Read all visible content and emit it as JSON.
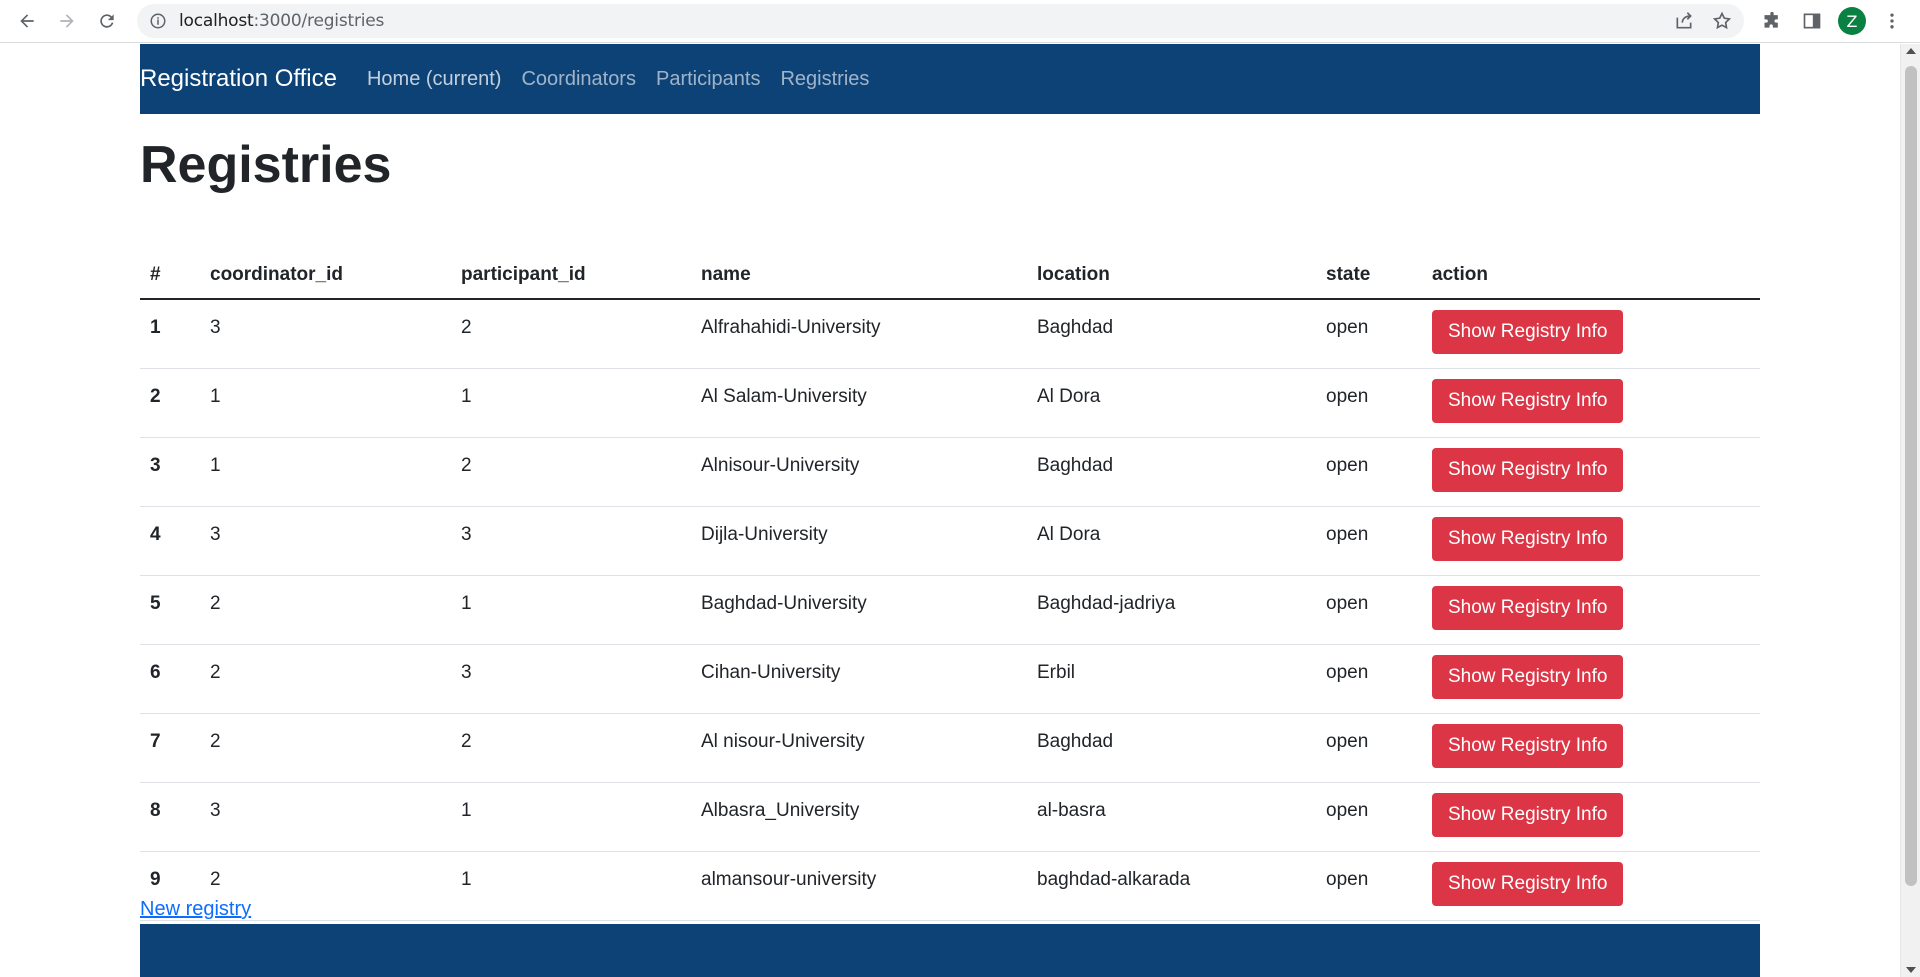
{
  "browser": {
    "url_host": "localhost",
    "url_path": ":3000/registries",
    "avatar_letter": "Z"
  },
  "navbar": {
    "brand": "Registration Office",
    "links": [
      {
        "label": "Home (current)"
      },
      {
        "label": "Coordinators"
      },
      {
        "label": "Participants"
      },
      {
        "label": "Registries"
      }
    ]
  },
  "page_title": "Registries",
  "table": {
    "headers": [
      "#",
      "coordinator_id",
      "participant_id",
      "name",
      "location",
      "state",
      "action"
    ],
    "rows": [
      {
        "num": "1",
        "coordinator_id": "3",
        "participant_id": "2",
        "name": "Alfrahahidi-University",
        "location": "Baghdad",
        "state": "open",
        "action": "Show Registry Info"
      },
      {
        "num": "2",
        "coordinator_id": "1",
        "participant_id": "1",
        "name": "Al Salam-University",
        "location": "Al Dora",
        "state": "open",
        "action": "Show Registry Info"
      },
      {
        "num": "3",
        "coordinator_id": "1",
        "participant_id": "2",
        "name": "Alnisour-University",
        "location": "Baghdad",
        "state": "open",
        "action": "Show Registry Info"
      },
      {
        "num": "4",
        "coordinator_id": "3",
        "participant_id": "3",
        "name": "Dijla-University",
        "location": "Al Dora",
        "state": "open",
        "action": "Show Registry Info"
      },
      {
        "num": "5",
        "coordinator_id": "2",
        "participant_id": "1",
        "name": "Baghdad-University",
        "location": "Baghdad-jadriya",
        "state": "open",
        "action": "Show Registry Info"
      },
      {
        "num": "6",
        "coordinator_id": "2",
        "participant_id": "3",
        "name": "Cihan-University",
        "location": "Erbil",
        "state": "open",
        "action": "Show Registry Info"
      },
      {
        "num": "7",
        "coordinator_id": "2",
        "participant_id": "2",
        "name": "Al nisour-University",
        "location": "Baghdad",
        "state": "open",
        "action": "Show Registry Info"
      },
      {
        "num": "8",
        "coordinator_id": "3",
        "participant_id": "1",
        "name": "Albasra_University",
        "location": "al-basra",
        "state": "open",
        "action": "Show Registry Info"
      },
      {
        "num": "9",
        "coordinator_id": "2",
        "participant_id": "1",
        "name": "almansour-university",
        "location": "baghdad-alkarada",
        "state": "open",
        "action": "Show Registry Info"
      }
    ]
  },
  "new_link": "New registry",
  "colors": {
    "navbar_bg": "#0d4277",
    "button_danger": "#dc3545",
    "link": "#0d6efd"
  }
}
